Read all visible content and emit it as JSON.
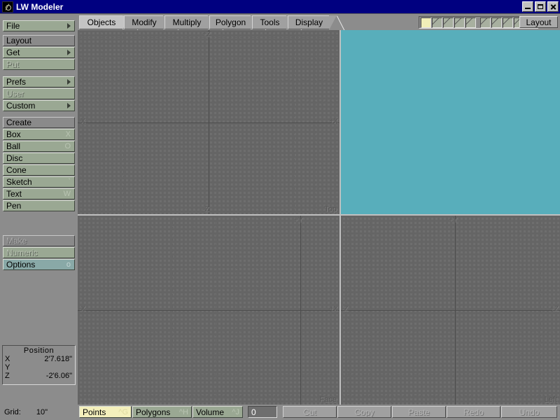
{
  "window": {
    "title": "LW Modeler",
    "icon": "lightwave-icon",
    "buttons": {
      "minimize": "minimize-icon",
      "maximize": "maximize-icon",
      "close": "close-icon"
    }
  },
  "sidebar": {
    "groups": [
      {
        "name": "file-group",
        "rows": [
          {
            "label": "File",
            "type": "button",
            "arrow": true,
            "shortcut": "",
            "enabled": true
          }
        ]
      },
      {
        "name": "layout-group",
        "rows": [
          {
            "label": "Layout",
            "type": "header",
            "arrow": false,
            "shortcut": "",
            "enabled": true
          },
          {
            "label": "Get",
            "type": "button",
            "arrow": true,
            "shortcut": "",
            "enabled": true
          },
          {
            "label": "Put",
            "type": "button",
            "arrow": false,
            "shortcut": "",
            "enabled": false
          }
        ]
      },
      {
        "name": "prefs-group",
        "rows": [
          {
            "label": "Prefs",
            "type": "button",
            "arrow": true,
            "shortcut": "",
            "enabled": true
          },
          {
            "label": "User",
            "type": "button",
            "arrow": false,
            "shortcut": "",
            "enabled": false
          },
          {
            "label": "Custom",
            "type": "button",
            "arrow": true,
            "shortcut": "",
            "enabled": true
          }
        ]
      },
      {
        "name": "create-group",
        "rows": [
          {
            "label": "Create",
            "type": "header",
            "arrow": false,
            "shortcut": "",
            "enabled": true
          },
          {
            "label": "Box",
            "type": "button",
            "arrow": false,
            "shortcut": "X",
            "enabled": true
          },
          {
            "label": "Ball",
            "type": "button",
            "arrow": false,
            "shortcut": "O",
            "enabled": true
          },
          {
            "label": "Disc",
            "type": "button",
            "arrow": false,
            "shortcut": "",
            "enabled": true
          },
          {
            "label": "Cone",
            "type": "button",
            "arrow": false,
            "shortcut": "",
            "enabled": true
          },
          {
            "label": "Sketch",
            "type": "button",
            "arrow": false,
            "shortcut": "`",
            "enabled": true
          },
          {
            "label": "Text",
            "type": "button",
            "arrow": false,
            "shortcut": "W",
            "enabled": true
          },
          {
            "label": "Pen",
            "type": "button",
            "arrow": false,
            "shortcut": "",
            "enabled": true
          }
        ]
      },
      {
        "name": "make-group",
        "rows": [
          {
            "label": "Make",
            "type": "header",
            "arrow": false,
            "shortcut": "",
            "enabled": false
          },
          {
            "label": "Numeric",
            "type": "button",
            "arrow": false,
            "shortcut": "",
            "enabled": false
          },
          {
            "label": "Options",
            "type": "teal",
            "arrow": false,
            "shortcut": "o",
            "enabled": true
          }
        ]
      }
    ]
  },
  "position": {
    "title": "Position",
    "rows": [
      {
        "axis": "X",
        "value": "2'7.618\""
      },
      {
        "axis": "Y",
        "value": ""
      },
      {
        "axis": "Z",
        "value": "-2'6.06\""
      }
    ]
  },
  "tabs": {
    "items": [
      {
        "label": "Objects",
        "selected": true
      },
      {
        "label": "Modify",
        "selected": false
      },
      {
        "label": "Multiply",
        "selected": false
      },
      {
        "label": "Polygon",
        "selected": false
      },
      {
        "label": "Tools",
        "selected": false
      },
      {
        "label": "Display",
        "selected": false
      }
    ],
    "layout_button": "Layout",
    "layers": [
      {
        "index": 1,
        "active": true
      },
      {
        "index": 2,
        "active": false
      },
      {
        "index": 3,
        "active": false
      },
      {
        "index": 4,
        "active": false
      },
      {
        "index": 5,
        "active": false
      },
      {
        "index": 6,
        "active": false
      },
      {
        "index": 7,
        "active": false
      },
      {
        "index": 8,
        "active": false
      },
      {
        "index": 9,
        "active": false
      },
      {
        "index": 10,
        "active": false
      }
    ]
  },
  "viewports": [
    {
      "name": "top",
      "label": "Top",
      "kind": "grid",
      "axis_labels": {
        "top": "+Z",
        "bottom": "-Z",
        "left": "-X",
        "right": "+X"
      }
    },
    {
      "name": "perspective",
      "label": "",
      "kind": "solid",
      "color": "#58aebb",
      "axis_labels": {}
    },
    {
      "name": "face",
      "label": "Face",
      "kind": "grid",
      "axis_labels": {
        "top": "+Y",
        "bottom": "",
        "left": "-X",
        "right": "+X"
      }
    },
    {
      "name": "left",
      "label": "Left",
      "kind": "grid",
      "axis_labels": {
        "top": "+Y",
        "bottom": "",
        "left": "-Z",
        "right": "+Z"
      }
    }
  ],
  "statusbar": {
    "grid_label": "Grid:",
    "grid_value": "10\"",
    "selection_modes": [
      {
        "label": "Points",
        "shortcut": "^G",
        "selected": true
      },
      {
        "label": "Polygons",
        "shortcut": "^H",
        "selected": false
      },
      {
        "label": "Volume",
        "shortcut": "^J",
        "selected": false
      }
    ],
    "count_value": "0",
    "edit_buttons": [
      {
        "label": "Cut",
        "enabled": false
      },
      {
        "label": "Copy",
        "enabled": false
      },
      {
        "label": "Paste",
        "enabled": false
      },
      {
        "label": "Redo",
        "enabled": false
      },
      {
        "label": "Undo",
        "enabled": false
      }
    ]
  },
  "colors": {
    "titlebar": "#000080",
    "chrome": "#8c8c8c",
    "button_face": "#9aa893",
    "viewport": "#6e6e6e",
    "perspective": "#58aebb",
    "selected_yellow": "#f4f0bc",
    "teal_button": "#89a9a7"
  }
}
